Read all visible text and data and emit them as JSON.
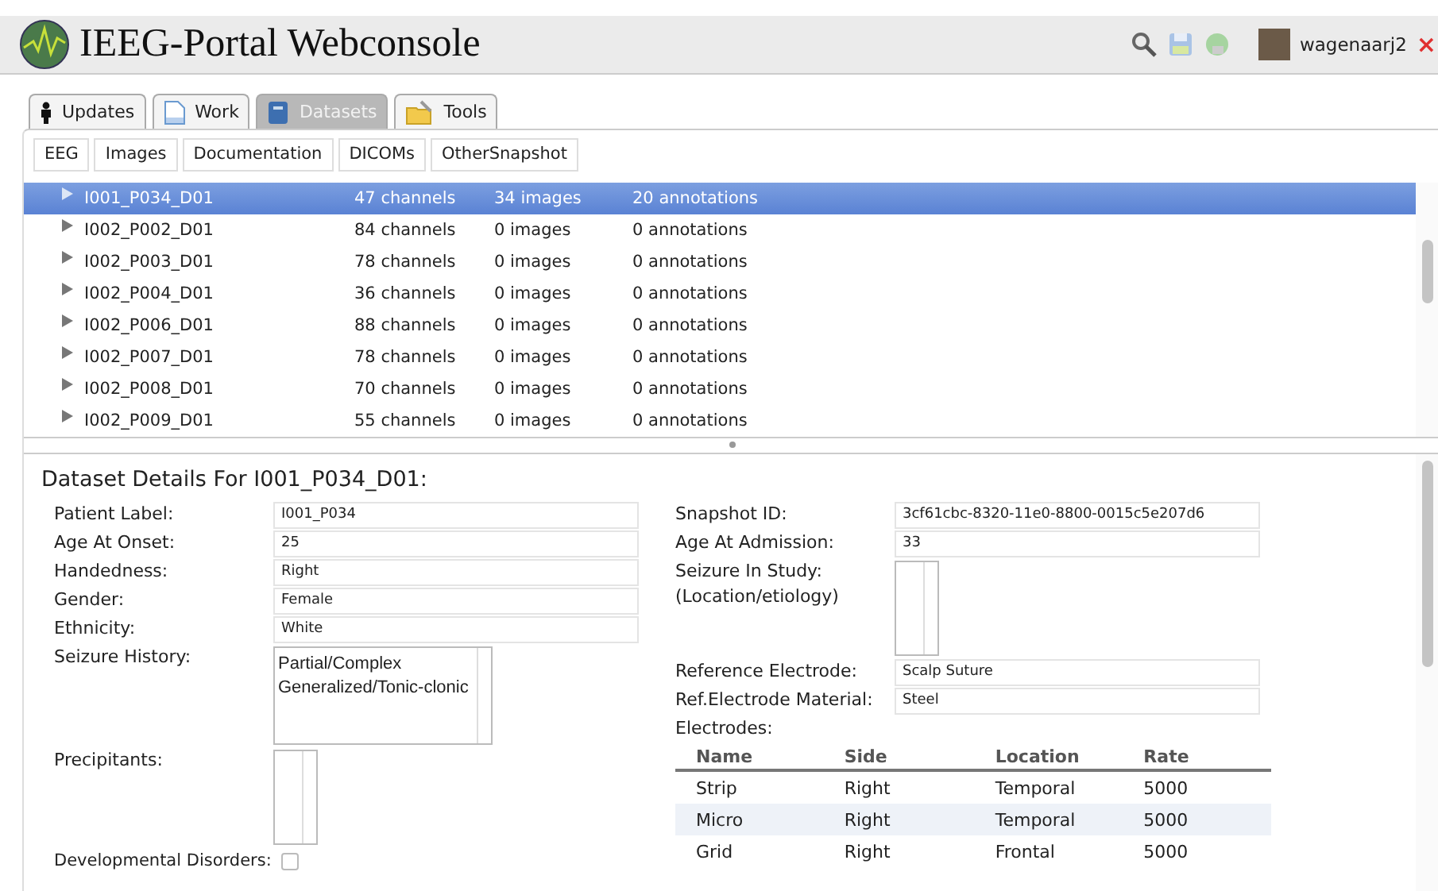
{
  "header": {
    "title": "IEEG-Portal Webconsole",
    "user": "wagenaarj2",
    "close": "×"
  },
  "tabs": [
    {
      "label": "Updates",
      "selected": false
    },
    {
      "label": "Work",
      "selected": false
    },
    {
      "label": "Datasets",
      "selected": true
    },
    {
      "label": "Tools",
      "selected": false
    }
  ],
  "subtabs": [
    "EEG",
    "Images",
    "Documentation",
    "DICOMs",
    "OtherSnapshot"
  ],
  "datasets": [
    {
      "name": "I001_P034_D01",
      "channels": "47 channels",
      "images": "34 images",
      "annotations": "20 annotations",
      "selected": true
    },
    {
      "name": "I002_P002_D01",
      "channels": "84 channels",
      "images": "0 images",
      "annotations": "0 annotations",
      "selected": false
    },
    {
      "name": "I002_P003_D01",
      "channels": "78 channels",
      "images": "0 images",
      "annotations": "0 annotations",
      "selected": false
    },
    {
      "name": "I002_P004_D01",
      "channels": "36 channels",
      "images": "0 images",
      "annotations": "0 annotations",
      "selected": false
    },
    {
      "name": "I002_P006_D01",
      "channels": "88 channels",
      "images": "0 images",
      "annotations": "0 annotations",
      "selected": false
    },
    {
      "name": "I002_P007_D01",
      "channels": "78 channels",
      "images": "0 images",
      "annotations": "0 annotations",
      "selected": false
    },
    {
      "name": "I002_P008_D01",
      "channels": "70 channels",
      "images": "0 images",
      "annotations": "0 annotations",
      "selected": false
    },
    {
      "name": "I002_P009_D01",
      "channels": "55 channels",
      "images": "0 images",
      "annotations": "0 annotations",
      "selected": false
    }
  ],
  "details": {
    "title": "Dataset Details For I001_P034_D01:",
    "left": [
      {
        "kind": "text",
        "label": "Patient Label:",
        "value": "I001_P034"
      },
      {
        "kind": "text",
        "label": "Age At Onset:",
        "value": "25"
      },
      {
        "kind": "text",
        "label": "Handedness:",
        "value": "Right"
      },
      {
        "kind": "text",
        "label": "Gender:",
        "value": "Female"
      },
      {
        "kind": "text",
        "label": "Ethnicity:",
        "value": "White"
      },
      {
        "kind": "list",
        "label": "Seizure History:",
        "items": [
          "Partial/Complex",
          "Generalized/Tonic-clonic"
        ]
      },
      {
        "kind": "list",
        "label": "Precipitants:"
      },
      {
        "kind": "checkbox",
        "label": "Developmental Disorders:",
        "checked": false
      }
    ],
    "right": [
      {
        "kind": "text",
        "label": "Snapshot ID:",
        "value": "3cf61cbc-8320-11e0-8800-0015c5e207d6"
      },
      {
        "kind": "text",
        "label": "Age At Admission:",
        "value": "33"
      },
      {
        "kind": "list",
        "label": "Seizure In Study:",
        "sublabel": "(Location/etiology)"
      },
      {
        "kind": "text",
        "label": "Reference Electrode:",
        "value": "Scalp Suture"
      },
      {
        "kind": "text",
        "label": "Ref.Electrode Material:",
        "value": "Steel"
      }
    ],
    "electrodes": {
      "label": "Electrodes:",
      "columns": [
        "Name",
        "Side",
        "Location",
        "Rate"
      ],
      "rows": [
        [
          "Strip",
          "Right",
          "Temporal",
          "5000"
        ],
        [
          "Micro",
          "Right",
          "Temporal",
          "5000"
        ],
        [
          "Grid",
          "Right",
          "Frontal",
          "5000"
        ]
      ]
    }
  }
}
